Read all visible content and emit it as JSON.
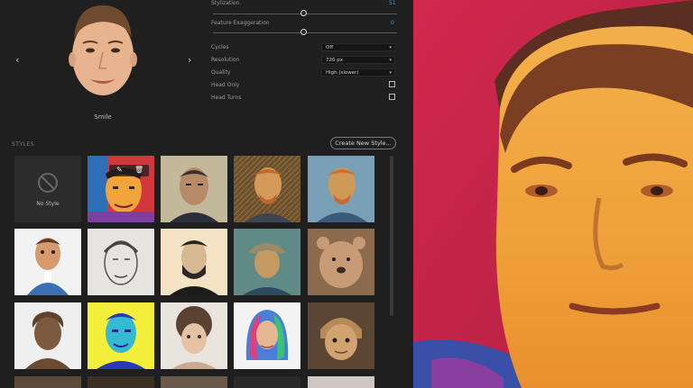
{
  "face_selector": {
    "label": "Smile",
    "prev_arrow": "‹",
    "next_arrow": "›"
  },
  "sliders": [
    {
      "label": "Stylization",
      "value": "51"
    },
    {
      "label": "Feature Exaggeration",
      "value": "0"
    }
  ],
  "settings": [
    {
      "label": "Cycles",
      "value": "Off"
    },
    {
      "label": "Resolution",
      "value": "720 px"
    },
    {
      "label": "Quality",
      "value": "High (slower)"
    }
  ],
  "toggles": [
    {
      "label": "Head Only",
      "checked": false
    },
    {
      "label": "Head Turns",
      "checked": false
    }
  ],
  "styles": {
    "heading": "STYLES",
    "create_button": "Create New Style...",
    "no_style_label": "No Style",
    "tiles": [
      {
        "icon": "no-style-icon",
        "selected": false
      },
      {
        "icon": "colorful-painted-face",
        "selected": true
      },
      {
        "icon": "realistic-portrait"
      },
      {
        "icon": "van-gogh-portrait"
      },
      {
        "icon": "van-gogh-blue-portrait"
      },
      {
        "icon": "cartoon-3d-man"
      },
      {
        "icon": "pencil-sketch-face"
      },
      {
        "icon": "lincoln-engraving"
      },
      {
        "icon": "van-gogh-hat-portrait"
      },
      {
        "icon": "bear-sculpture"
      },
      {
        "icon": "bronze-bust"
      },
      {
        "icon": "pop-art-face"
      },
      {
        "icon": "sketch-child"
      },
      {
        "icon": "rainbow-hair-woman"
      },
      {
        "icon": "wooden-carving"
      }
    ]
  },
  "colors": {
    "accent": "#2f7be0",
    "panel": "#1f1f20",
    "preview_red": "#c7264a"
  }
}
